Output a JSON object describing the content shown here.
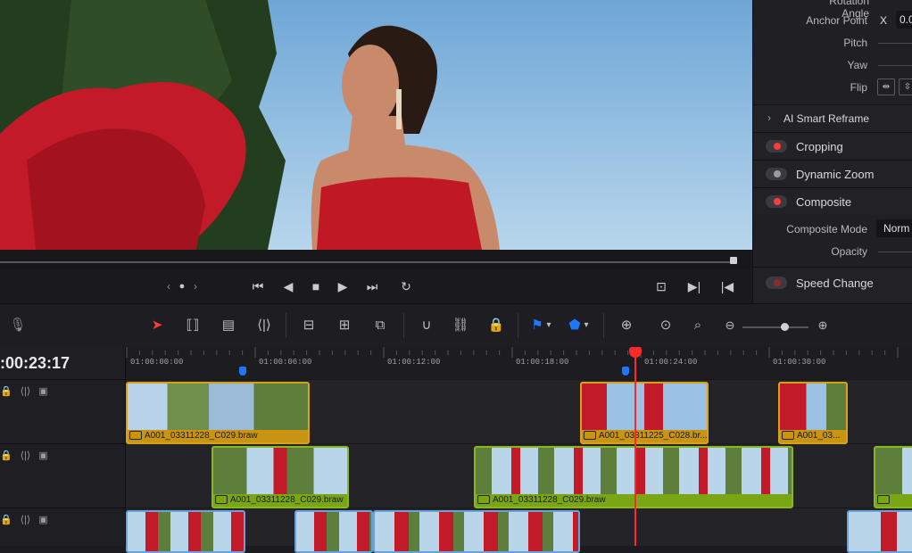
{
  "inspector": {
    "rotation_label": "Rotation Angle",
    "anchor_label": "Anchor Point",
    "anchor_axis": "X",
    "anchor_value": "0.0",
    "pitch_label": "Pitch",
    "yaw_label": "Yaw",
    "flip_label": "Flip",
    "sections": [
      {
        "title": "AI Smart Reframe",
        "type": "chevron"
      },
      {
        "title": "Cropping",
        "type": "toggle",
        "state": "on"
      },
      {
        "title": "Dynamic Zoom",
        "type": "toggle",
        "state": "off"
      },
      {
        "title": "Composite",
        "type": "toggle",
        "state": "on"
      }
    ],
    "composite_mode_label": "Composite Mode",
    "composite_mode_value": "Norm",
    "opacity_label": "Opacity",
    "speed_change_label": "Speed Change"
  },
  "timeline": {
    "timecode": ":00:23:17",
    "ruler": [
      "01:00:00:00",
      "01:00:06:00",
      "01:00:12:00",
      "01:00:18:00",
      "01:00:24:00",
      "01:00:30:00"
    ],
    "clips": {
      "v3": [
        "A001_03311228_C029.braw",
        "A001_03311225_C028.br...",
        "A001_03..."
      ],
      "v2": [
        "A001_03311228_C029.braw",
        "A001_03311228_C029.braw"
      ]
    }
  },
  "colors": {
    "accent_red": "#ff2828",
    "clip_orange": "#d7a21a",
    "clip_green": "#8ab71e",
    "marker_blue": "#1e78ff"
  }
}
